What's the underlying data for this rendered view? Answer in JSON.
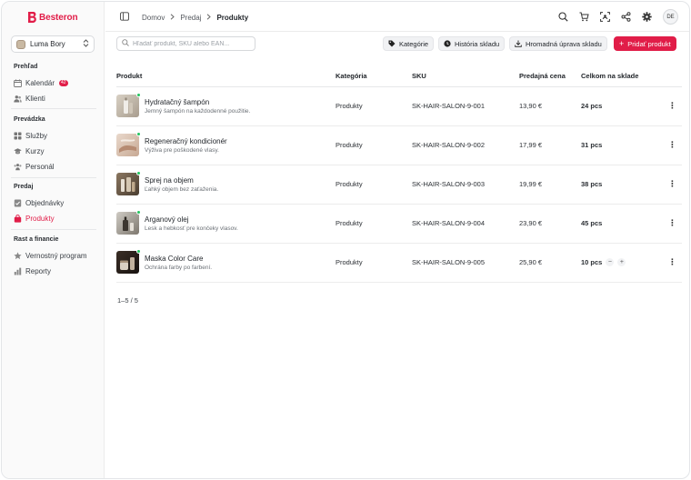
{
  "app": {
    "brand": "Besteron",
    "store": "Luma Bory",
    "user_initials": "DE"
  },
  "sidebar": {
    "sections": [
      {
        "label": "Prehľad",
        "items": [
          {
            "label": "Kalendár",
            "icon": "calendar-icon",
            "badge": "42"
          },
          {
            "label": "Klienti",
            "icon": "users-icon"
          }
        ]
      },
      {
        "label": "Prevádzka",
        "items": [
          {
            "label": "Služby",
            "icon": "grid-icon"
          },
          {
            "label": "Kurzy",
            "icon": "graduation-cap-icon"
          },
          {
            "label": "Personál",
            "icon": "team-icon"
          }
        ]
      },
      {
        "label": "Predaj",
        "items": [
          {
            "label": "Objednávky",
            "icon": "order-icon"
          },
          {
            "label": "Produkty",
            "icon": "shopping-bag-icon",
            "active": true
          }
        ]
      },
      {
        "label": "Rast a financie",
        "items": [
          {
            "label": "Vernostný program",
            "icon": "star-icon"
          },
          {
            "label": "Reporty",
            "icon": "bar-chart-icon"
          }
        ]
      }
    ]
  },
  "breadcrumb": [
    "Domov",
    "Predaj",
    "Produkty"
  ],
  "toolbar": {
    "search_placeholder": "Hľadať produkt, SKU alebo EAN...",
    "categories": "Kategórie",
    "history": "História skladu",
    "bulk": "Hromadná úprava skladu",
    "add": "Pridať produkt"
  },
  "table": {
    "headers": [
      "Produkt",
      "Kategória",
      "SKU",
      "Predajná cena",
      "Celkom na sklade"
    ],
    "rows": [
      {
        "name": "Hydratačný šampón",
        "desc": "Jemný šampón na každodenné použitie.",
        "category": "Produkty",
        "sku": "SK-HAIR-SALON-9-001",
        "price": "13,90 €",
        "stock": "24 pcs"
      },
      {
        "name": "Regeneračný kondicionér",
        "desc": "Výživa pre poškodené vlasy.",
        "category": "Produkty",
        "sku": "SK-HAIR-SALON-9-002",
        "price": "17,99 €",
        "stock": "31 pcs"
      },
      {
        "name": "Sprej na objem",
        "desc": "Ľahký objem bez zaťaženia.",
        "category": "Produkty",
        "sku": "SK-HAIR-SALON-9-003",
        "price": "19,99 €",
        "stock": "38 pcs"
      },
      {
        "name": "Arganový olej",
        "desc": "Lesk a hebkosť pre končeky vlasov.",
        "category": "Produkty",
        "sku": "SK-HAIR-SALON-9-004",
        "price": "23,90 €",
        "stock": "45 pcs"
      },
      {
        "name": "Maska Color Care",
        "desc": "Ochrána farby po farbení.",
        "category": "Produkty",
        "sku": "SK-HAIR-SALON-9-005",
        "price": "25,90 €",
        "stock": "10 pcs"
      }
    ]
  },
  "pagination": "1–5 / 5",
  "colors": {
    "accent": "#e11d48",
    "status_dot": "#22c55e"
  }
}
